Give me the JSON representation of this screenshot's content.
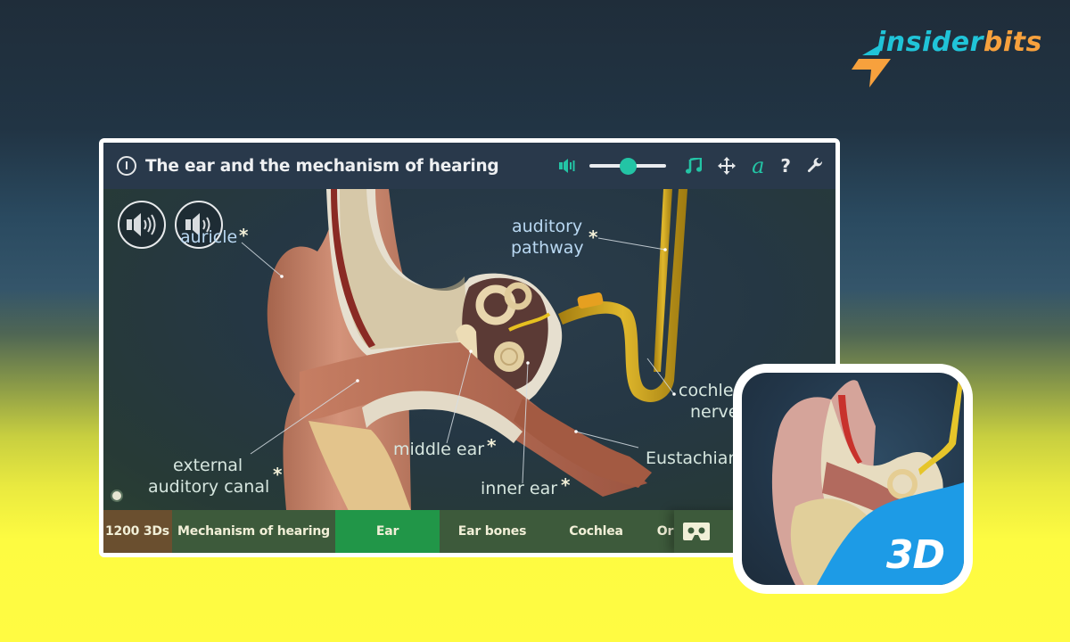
{
  "brand": {
    "logo_part1": "insider",
    "logo_part2": "bits",
    "colors": {
      "cyan": "#20c4d8",
      "orange": "#f7a13d"
    }
  },
  "window": {
    "title": "The ear and the mechanism of hearing",
    "toolbar": {
      "volume_level": 0.5,
      "icons": [
        "volume-icon",
        "music-note-icon",
        "move-arrows-icon",
        "font-a-icon",
        "help-icon",
        "wrench-icon"
      ],
      "help_label": "?",
      "font_label": "a",
      "accent_color": "#23c4a5"
    }
  },
  "viewport": {
    "audio_buttons": [
      "speaker-loud-icon",
      "speaker-soft-icon"
    ],
    "labels": {
      "auricle": "auricle",
      "auditory_pathway_1": "auditory",
      "auditory_pathway_2": "pathway",
      "cochlear_nerve_1": "cochlear",
      "cochlear_nerve_2": "nerve",
      "eustachian": "Eustachian",
      "external_canal_1": "external",
      "external_canal_2": "auditory canal",
      "middle_ear": "middle ear",
      "inner_ear": "inner ear",
      "asterisk": "*"
    }
  },
  "nav": {
    "items": [
      {
        "label": "1200 3Ds",
        "style": "brown"
      },
      {
        "label": "Mechanism of hearing",
        "style": "normal"
      },
      {
        "label": "Ear",
        "style": "active"
      },
      {
        "label": "Ear bones",
        "style": "normal"
      },
      {
        "label": "Cochlea",
        "style": "normal"
      },
      {
        "label": "Or",
        "style": "normal"
      }
    ],
    "active_color": "#219648"
  },
  "app_icon": {
    "badge_text": "3D",
    "badge_color": "#1d9be6"
  }
}
